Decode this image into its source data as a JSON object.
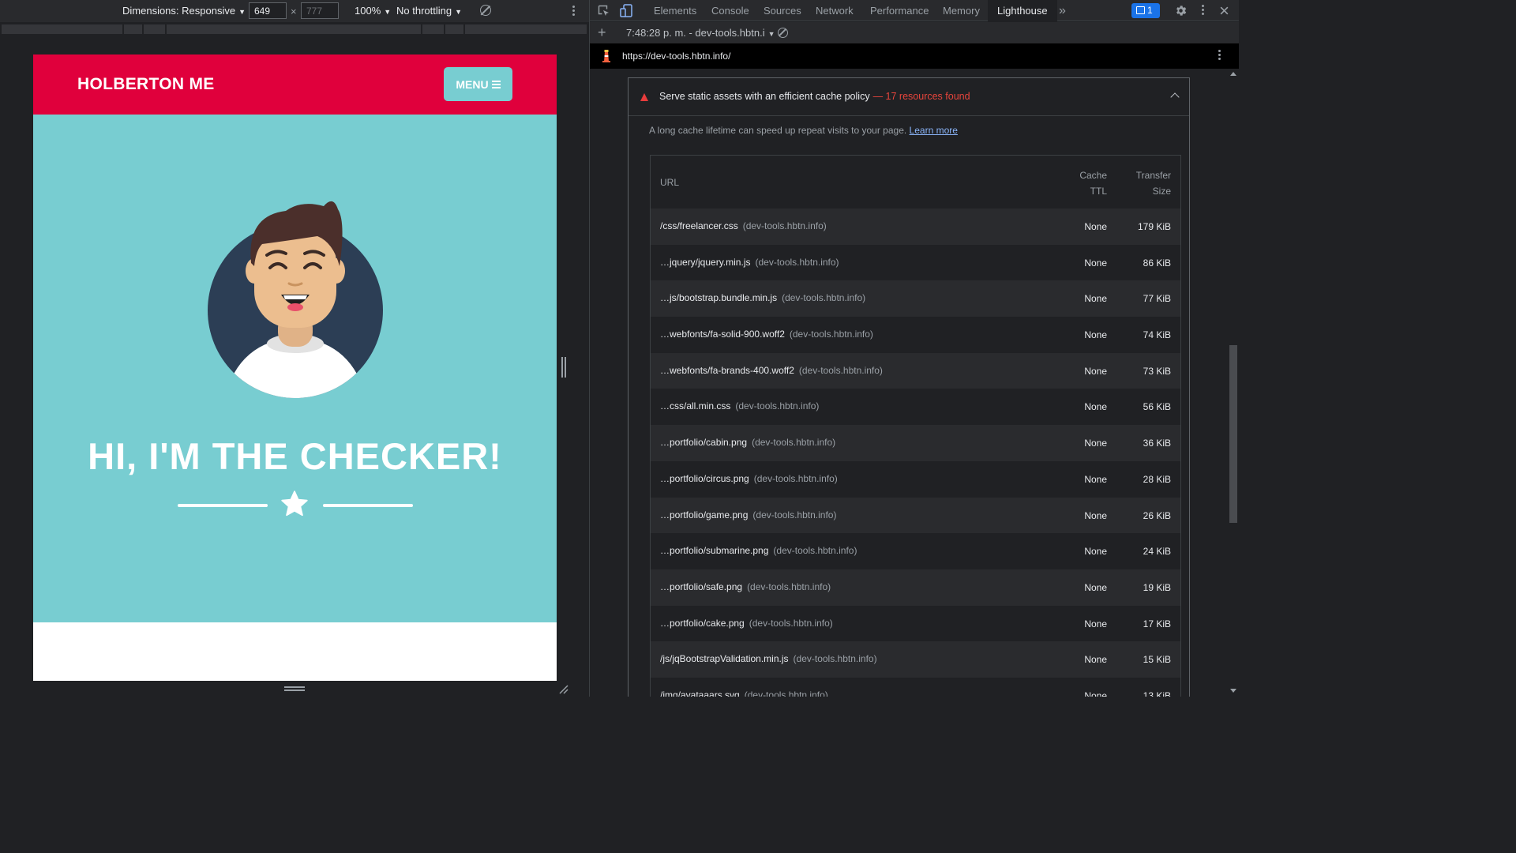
{
  "device_toolbar": {
    "dimensions_label": "Dimensions: Responsive",
    "width_value": "649",
    "height_placeholder": "777",
    "times": "×",
    "zoom": "100%",
    "throttling": "No throttling"
  },
  "site": {
    "brand": "HOLBERTON ME",
    "menu_label": "MENU",
    "hero_title": "HI, I'M THE CHECKER!",
    "colors": {
      "nav": "#e0003c",
      "masthead": "#78cdd1"
    }
  },
  "devtools": {
    "tabs": [
      "Elements",
      "Console",
      "Sources",
      "Network",
      "Performance",
      "Memory",
      "Lighthouse"
    ],
    "active_tab": "Lighthouse",
    "more_tabs": "»",
    "issues_count": "1",
    "report_label": "7:48:28 p. m. - dev-tools.hbtn.i",
    "report_url": "https://dev-tools.hbtn.info/"
  },
  "audit": {
    "title": "Serve static assets with an efficient cache policy",
    "display_value": "— 17 resources found",
    "description": "A long cache lifetime can speed up repeat visits to your page.",
    "learn_more": "Learn more",
    "headers": {
      "url": "URL",
      "ttl_1": "Cache",
      "ttl_2": "TTL",
      "size_1": "Transfer",
      "size_2": "Size"
    },
    "rows": [
      {
        "url": "/css/freelancer.css",
        "host": "(dev-tools.hbtn.info)",
        "ttl": "None",
        "size": "179 KiB"
      },
      {
        "url": "…jquery/jquery.min.js",
        "host": "(dev-tools.hbtn.info)",
        "ttl": "None",
        "size": "86 KiB"
      },
      {
        "url": "…js/bootstrap.bundle.min.js",
        "host": "(dev-tools.hbtn.info)",
        "ttl": "None",
        "size": "77 KiB"
      },
      {
        "url": "…webfonts/fa-solid-900.woff2",
        "host": "(dev-tools.hbtn.info)",
        "ttl": "None",
        "size": "74 KiB"
      },
      {
        "url": "…webfonts/fa-brands-400.woff2",
        "host": "(dev-tools.hbtn.info)",
        "ttl": "None",
        "size": "73 KiB"
      },
      {
        "url": "…css/all.min.css",
        "host": "(dev-tools.hbtn.info)",
        "ttl": "None",
        "size": "56 KiB"
      },
      {
        "url": "…portfolio/cabin.png",
        "host": "(dev-tools.hbtn.info)",
        "ttl": "None",
        "size": "36 KiB"
      },
      {
        "url": "…portfolio/circus.png",
        "host": "(dev-tools.hbtn.info)",
        "ttl": "None",
        "size": "28 KiB"
      },
      {
        "url": "…portfolio/game.png",
        "host": "(dev-tools.hbtn.info)",
        "ttl": "None",
        "size": "26 KiB"
      },
      {
        "url": "…portfolio/submarine.png",
        "host": "(dev-tools.hbtn.info)",
        "ttl": "None",
        "size": "24 KiB"
      },
      {
        "url": "…portfolio/safe.png",
        "host": "(dev-tools.hbtn.info)",
        "ttl": "None",
        "size": "19 KiB"
      },
      {
        "url": "…portfolio/cake.png",
        "host": "(dev-tools.hbtn.info)",
        "ttl": "None",
        "size": "17 KiB"
      },
      {
        "url": "/js/jqBootstrapValidation.min.js",
        "host": "(dev-tools.hbtn.info)",
        "ttl": "None",
        "size": "15 KiB"
      },
      {
        "url": "/img/avataaars.svg",
        "host": "(dev-tools.hbtn.info)",
        "ttl": "None",
        "size": "13 KiB"
      }
    ]
  }
}
